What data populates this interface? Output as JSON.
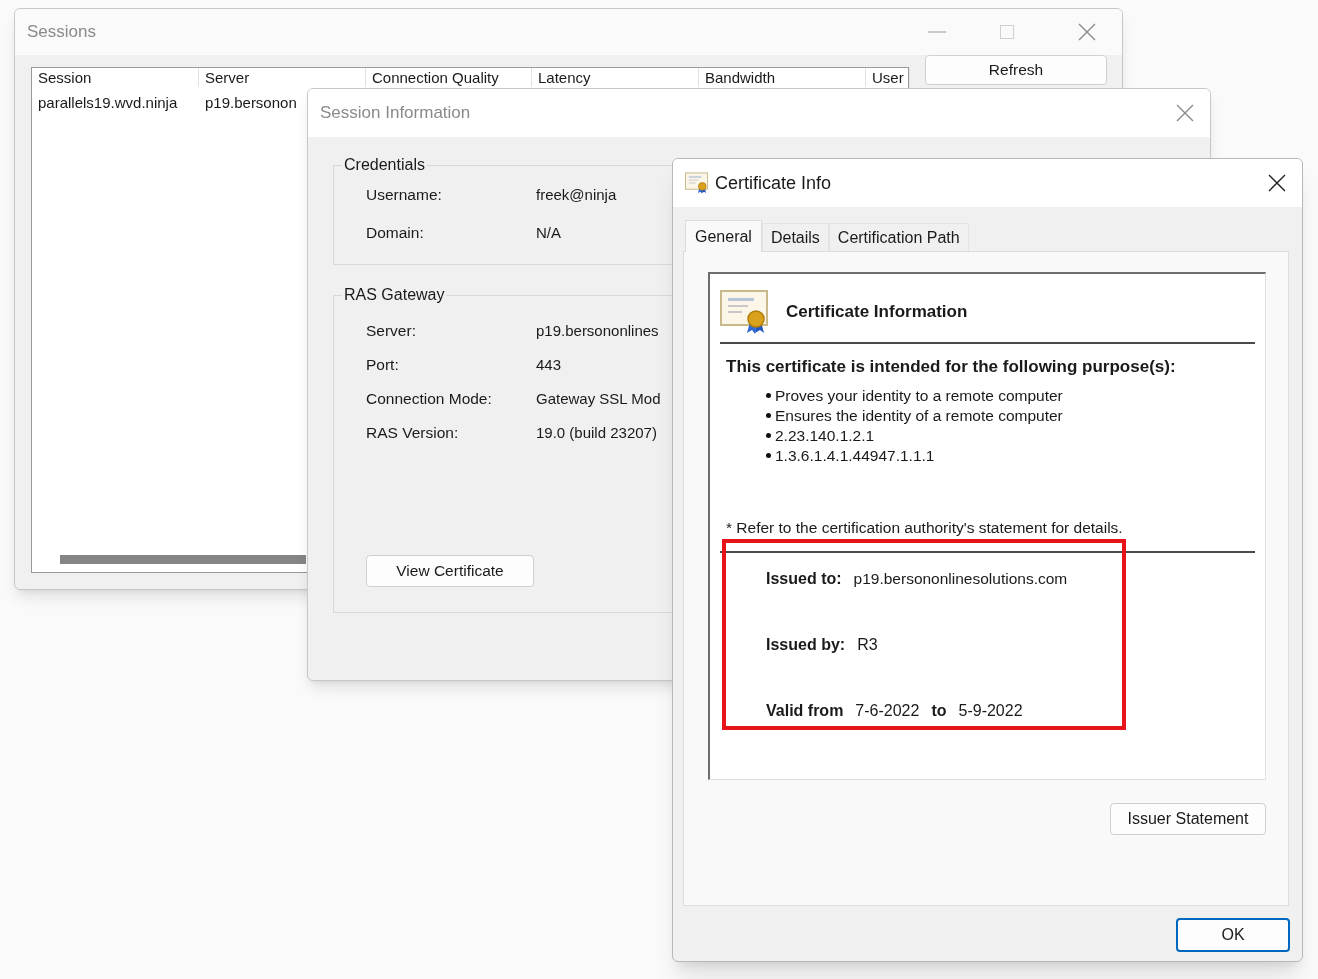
{
  "sessions_window": {
    "title": "Sessions",
    "columns": [
      "Session",
      "Server",
      "Connection Quality",
      "Latency",
      "Bandwidth",
      "User"
    ],
    "rows": [
      [
        "parallels19.wvd.ninja",
        "p19.bersonon"
      ]
    ],
    "refresh_button": "Refresh"
  },
  "session_information": {
    "title": "Session Information",
    "groups": [
      {
        "title": "Credentials",
        "fields": [
          {
            "label": "Username:",
            "value": "freek@ninja"
          },
          {
            "label": "Domain:",
            "value": "N/A"
          }
        ]
      },
      {
        "title": "RAS Gateway",
        "fields": [
          {
            "label": "Server:",
            "value": "p19.bersononlines"
          },
          {
            "label": "Port:",
            "value": "443"
          },
          {
            "label": "Connection Mode:",
            "value": "Gateway SSL Mod"
          },
          {
            "label": "RAS Version:",
            "value": "19.0 (build 23207)"
          }
        ],
        "button": "View Certificate"
      }
    ]
  },
  "certificate_info": {
    "title": "Certificate Info",
    "tabs": [
      {
        "label": "General",
        "selected": true
      },
      {
        "label": "Details",
        "selected": false
      },
      {
        "label": "Certification Path",
        "selected": false
      }
    ],
    "heading": "Certificate Information",
    "purpose_title": "This certificate is intended for the following purpose(s):",
    "purposes": [
      "Proves your identity to a remote computer",
      "Ensures the identity of a remote computer",
      "2.23.140.1.2.1",
      "1.3.6.1.4.1.44947.1.1.1"
    ],
    "note": "* Refer to the certification authority's statement for details.",
    "issued_to_label": "Issued to:",
    "issued_to": "p19.bersononlinesolutions.com",
    "issued_by_label": "Issued by:",
    "issued_by": "R3",
    "valid_from_label": "Valid from",
    "valid_from": "7-6-2022",
    "valid_to_label": "to",
    "valid_to": "5-9-2022",
    "issuer_statement_button": "Issuer Statement",
    "ok_button": "OK"
  }
}
